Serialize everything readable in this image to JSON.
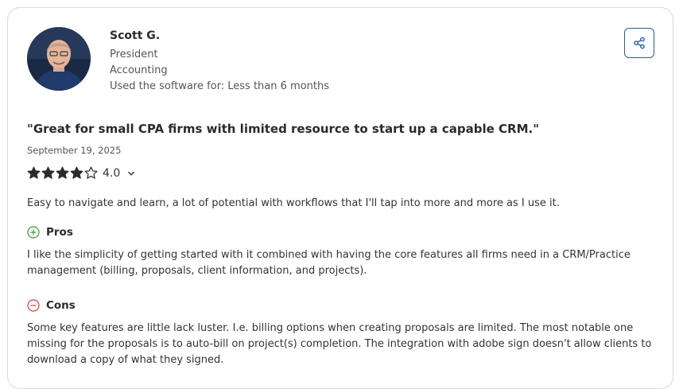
{
  "reviewer": {
    "name": "Scott G.",
    "role": "President",
    "industry": "Accounting",
    "usage": "Used the software for: Less than 6 months"
  },
  "review": {
    "title": "\"Great for small CPA firms with limited resource to start up a capable CRM.\"",
    "date": "September 19, 2025",
    "rating": 4.0,
    "rating_label": "4.0",
    "stars_max": 5,
    "summary": "Easy to navigate and learn, a lot of potential with workflows that I'll tap into more and more as I use it.",
    "pros_label": "Pros",
    "pros_text": "I like the simplicity of getting started with it combined with having the core features all firms need in a CRM/Practice management (billing, proposals, client information, and projects).",
    "cons_label": "Cons",
    "cons_text": "Some key features are little lack luster. I.e. billing options when creating proposals are limited. The most notable one missing for the proposals is to auto-bill on project(s) completion. The integration with adobe sign doesn't allow clients to download a copy of what they signed."
  },
  "icons": {
    "share": "share-icon",
    "pros": "plus-circle-icon",
    "cons": "minus-circle-icon",
    "expand": "chevron-down-icon"
  },
  "colors": {
    "share_border": "#1f5fa8",
    "pros_icon": "#3a9a3a",
    "cons_icon": "#d23c3c",
    "star": "#2b2b2b"
  }
}
